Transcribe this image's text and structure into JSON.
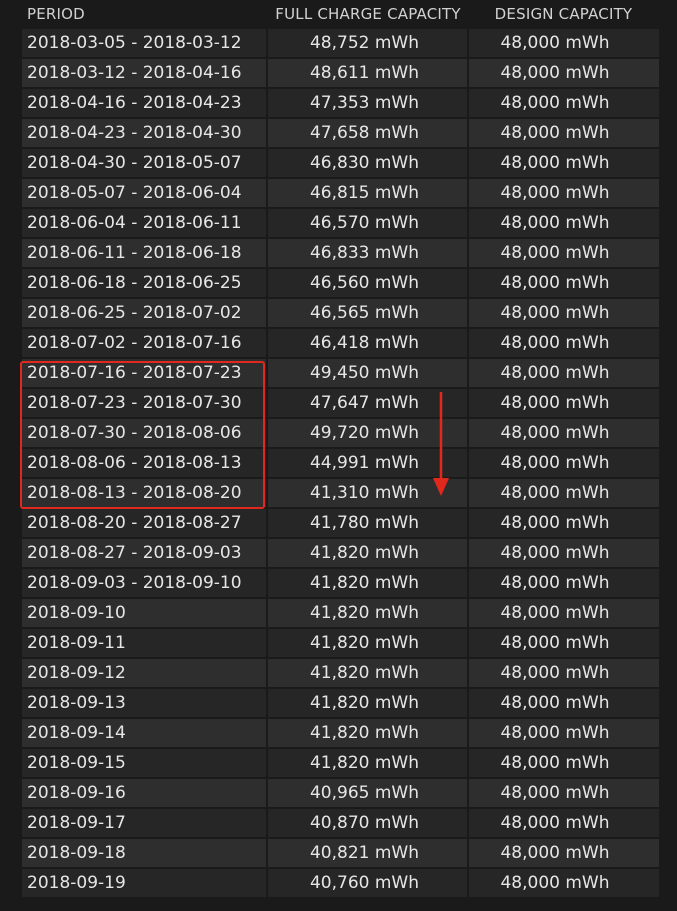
{
  "columns": {
    "period": "PERIOD",
    "full_charge": "FULL CHARGE CAPACITY",
    "design": "DESIGN CAPACITY"
  },
  "rows": [
    {
      "period": "2018-03-05 - 2018-03-12",
      "full": "48,752 mWh",
      "design": "48,000 mWh"
    },
    {
      "period": "2018-03-12 - 2018-04-16",
      "full": "48,611 mWh",
      "design": "48,000 mWh"
    },
    {
      "period": "2018-04-16 - 2018-04-23",
      "full": "47,353 mWh",
      "design": "48,000 mWh"
    },
    {
      "period": "2018-04-23 - 2018-04-30",
      "full": "47,658 mWh",
      "design": "48,000 mWh"
    },
    {
      "period": "2018-04-30 - 2018-05-07",
      "full": "46,830 mWh",
      "design": "48,000 mWh"
    },
    {
      "period": "2018-05-07 - 2018-06-04",
      "full": "46,815 mWh",
      "design": "48,000 mWh"
    },
    {
      "period": "2018-06-04 - 2018-06-11",
      "full": "46,570 mWh",
      "design": "48,000 mWh"
    },
    {
      "period": "2018-06-11 - 2018-06-18",
      "full": "46,833 mWh",
      "design": "48,000 mWh"
    },
    {
      "period": "2018-06-18 - 2018-06-25",
      "full": "46,560 mWh",
      "design": "48,000 mWh"
    },
    {
      "period": "2018-06-25 - 2018-07-02",
      "full": "46,565 mWh",
      "design": "48,000 mWh"
    },
    {
      "period": "2018-07-02 - 2018-07-16",
      "full": "46,418 mWh",
      "design": "48,000 mWh"
    },
    {
      "period": "2018-07-16 - 2018-07-23",
      "full": "49,450 mWh",
      "design": "48,000 mWh"
    },
    {
      "period": "2018-07-23 - 2018-07-30",
      "full": "47,647 mWh",
      "design": "48,000 mWh"
    },
    {
      "period": "2018-07-30 - 2018-08-06",
      "full": "49,720 mWh",
      "design": "48,000 mWh"
    },
    {
      "period": "2018-08-06 - 2018-08-13",
      "full": "44,991 mWh",
      "design": "48,000 mWh"
    },
    {
      "period": "2018-08-13 - 2018-08-20",
      "full": "41,310 mWh",
      "design": "48,000 mWh"
    },
    {
      "period": "2018-08-20 - 2018-08-27",
      "full": "41,780 mWh",
      "design": "48,000 mWh"
    },
    {
      "period": "2018-08-27 - 2018-09-03",
      "full": "41,820 mWh",
      "design": "48,000 mWh"
    },
    {
      "period": "2018-09-03 - 2018-09-10",
      "full": "41,820 mWh",
      "design": "48,000 mWh"
    },
    {
      "period": "2018-09-10",
      "full": "41,820 mWh",
      "design": "48,000 mWh"
    },
    {
      "period": "2018-09-11",
      "full": "41,820 mWh",
      "design": "48,000 mWh"
    },
    {
      "period": "2018-09-12",
      "full": "41,820 mWh",
      "design": "48,000 mWh"
    },
    {
      "period": "2018-09-13",
      "full": "41,820 mWh",
      "design": "48,000 mWh"
    },
    {
      "period": "2018-09-14",
      "full": "41,820 mWh",
      "design": "48,000 mWh"
    },
    {
      "period": "2018-09-15",
      "full": "41,820 mWh",
      "design": "48,000 mWh"
    },
    {
      "period": "2018-09-16",
      "full": "40,965 mWh",
      "design": "48,000 mWh"
    },
    {
      "period": "2018-09-17",
      "full": "40,870 mWh",
      "design": "48,000 mWh"
    },
    {
      "period": "2018-09-18",
      "full": "40,821 mWh",
      "design": "48,000 mWh"
    },
    {
      "period": "2018-09-19",
      "full": "40,760 mWh",
      "design": "48,000 mWh"
    }
  ],
  "annotation": {
    "highlight_color": "#e0281c",
    "arrow_icon": "down-arrow-icon",
    "highlighted_periods": [
      "2018-07-16 - 2018-07-23",
      "2018-07-23 - 2018-07-30",
      "2018-07-30 - 2018-08-06",
      "2018-08-06 - 2018-08-13",
      "2018-08-13 - 2018-08-20"
    ]
  }
}
